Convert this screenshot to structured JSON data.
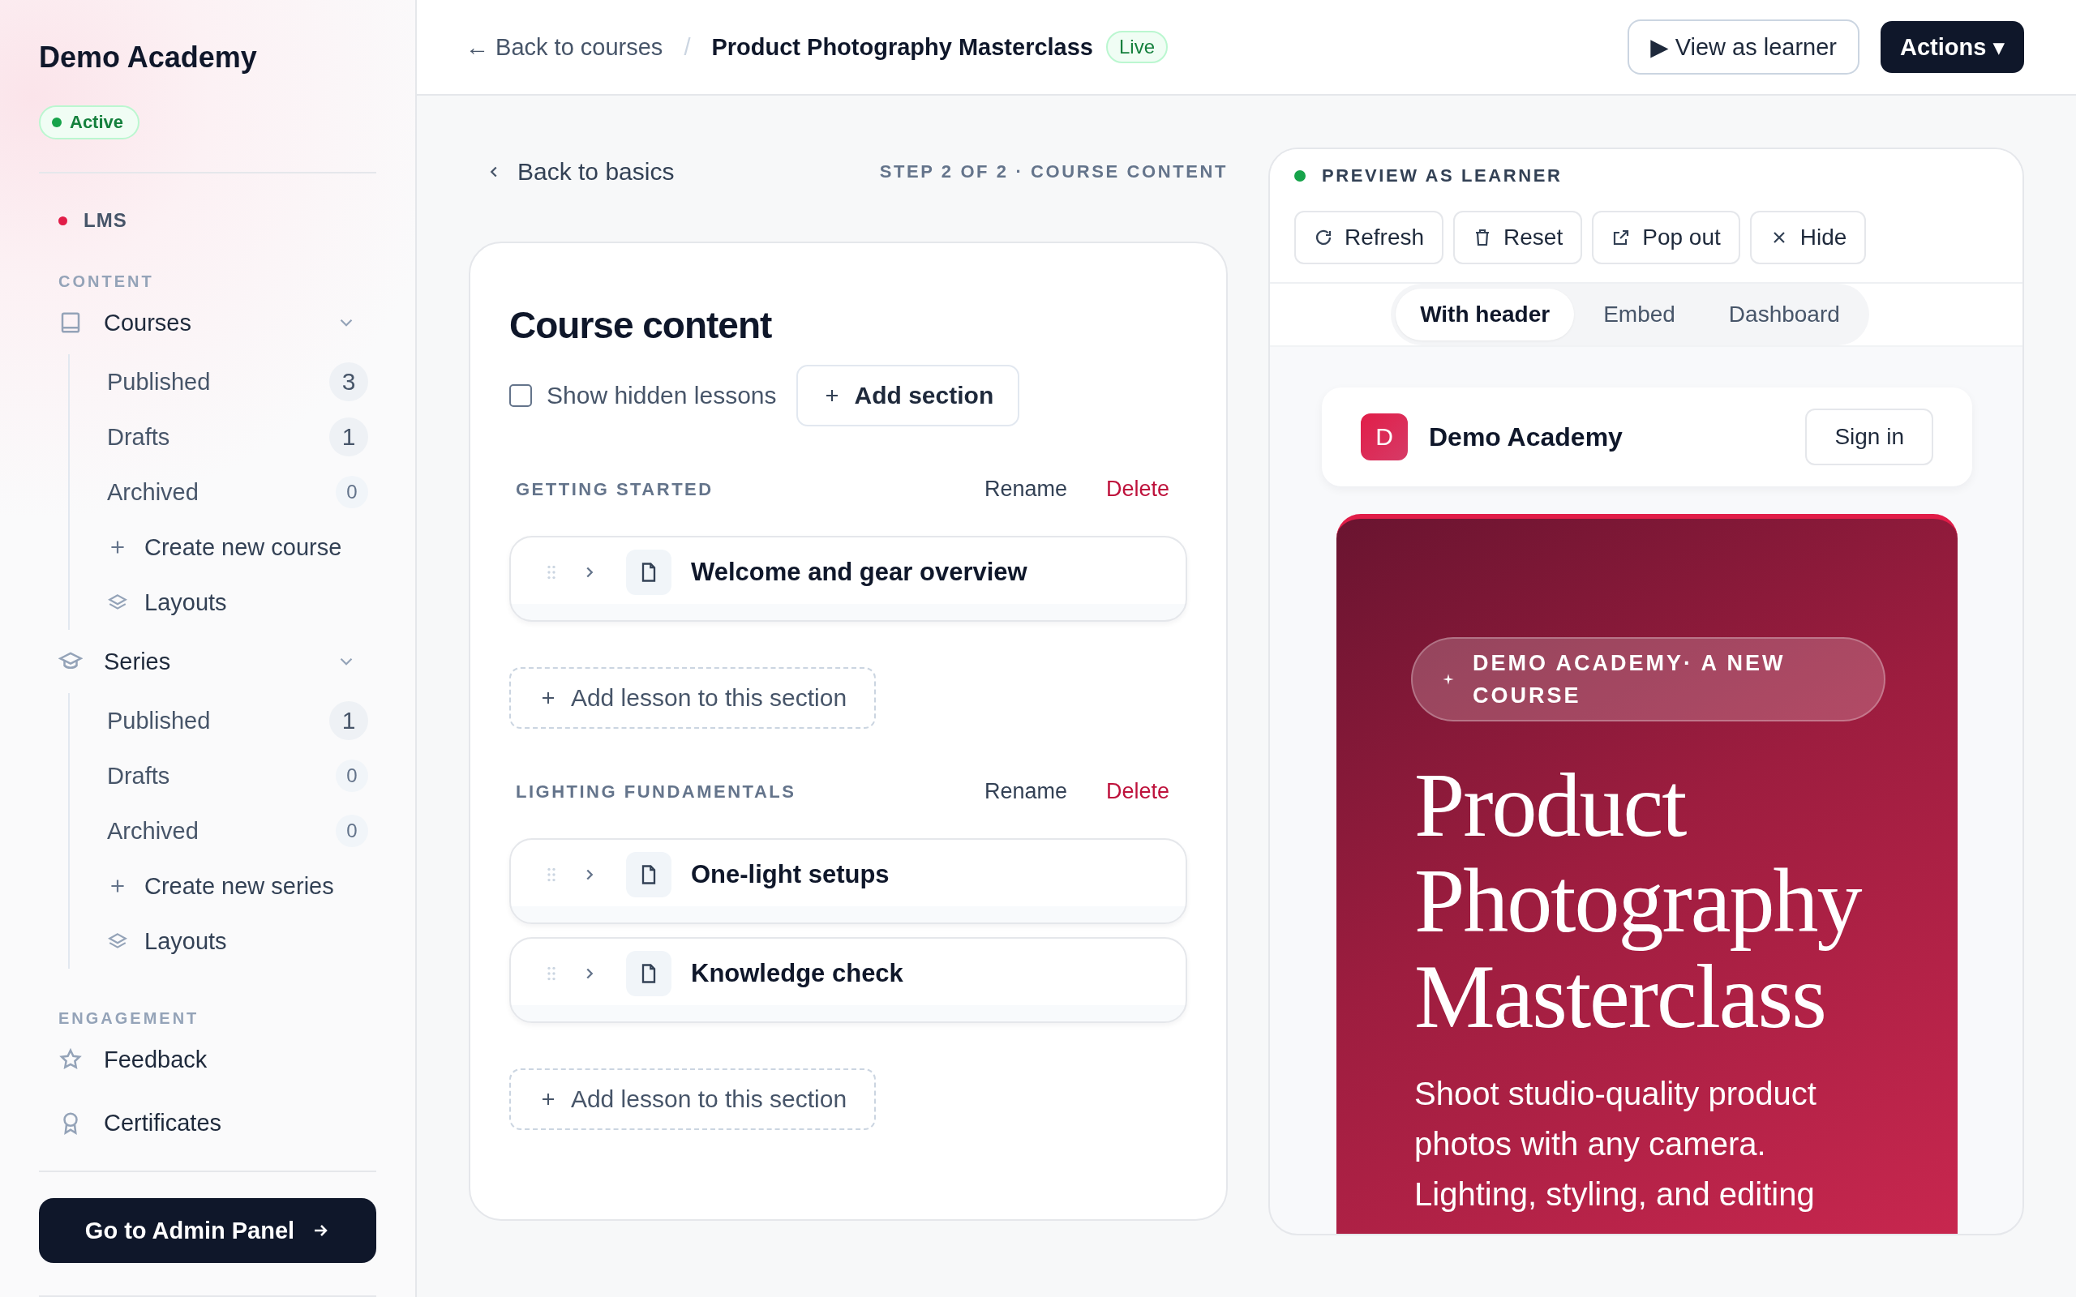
{
  "sidebar": {
    "title": "Demo Academy",
    "status": {
      "label": "Active"
    },
    "app": {
      "label": "LMS"
    },
    "groups": [
      {
        "heading": "CONTENT",
        "items": [
          {
            "label": "Courses",
            "kind": "book",
            "expanded": true,
            "children": [
              {
                "kind": "count",
                "label": "Published",
                "count": "3",
                "highlighted": true
              },
              {
                "kind": "count",
                "label": "Drafts",
                "count": "1",
                "highlighted": true
              },
              {
                "kind": "count",
                "label": "Archived",
                "count": "0",
                "highlighted": false
              },
              {
                "kind": "create",
                "label": "Create new course"
              },
              {
                "kind": "layouts",
                "label": "Layouts"
              }
            ]
          },
          {
            "label": "Series",
            "kind": "cap",
            "expanded": true,
            "children": [
              {
                "kind": "count",
                "label": "Published",
                "count": "1",
                "highlighted": true
              },
              {
                "kind": "count",
                "label": "Drafts",
                "count": "0",
                "highlighted": false
              },
              {
                "kind": "count",
                "label": "Archived",
                "count": "0",
                "highlighted": false
              },
              {
                "kind": "create",
                "label": "Create new series"
              },
              {
                "kind": "layouts",
                "label": "Layouts"
              }
            ]
          }
        ]
      },
      {
        "heading": "ENGAGEMENT",
        "items": [
          {
            "label": "Feedback",
            "kind": "star"
          },
          {
            "label": "Certificates",
            "kind": "ribbon"
          }
        ]
      }
    ],
    "admin_button": "Go to Admin Panel"
  },
  "topbar": {
    "back": "← Back to courses",
    "separator": "/",
    "crumb": "Product Photography Masterclass",
    "badge": "Live",
    "view_button": "▶ View as learner",
    "actions_button": "Actions ▾"
  },
  "editor": {
    "back": "Back to basics",
    "step": "STEP 2 OF 2 · COURSE CONTENT",
    "title": "Course content",
    "show_hidden": {
      "label": "Show hidden lessons",
      "checked": false
    },
    "add_section": "Add section",
    "sections": [
      {
        "name": "GETTING STARTED",
        "rename": "Rename",
        "delete": "Delete",
        "lessons": [
          {
            "title": "Welcome and gear overview"
          }
        ],
        "add_lesson": "Add lesson to this section"
      },
      {
        "name": "LIGHTING FUNDAMENTALS",
        "rename": "Rename",
        "delete": "Delete",
        "lessons": [
          {
            "title": "One-light setups"
          },
          {
            "title": "Knowledge check"
          }
        ],
        "add_lesson": "Add lesson to this section"
      }
    ]
  },
  "preview": {
    "heading": "PREVIEW AS LEARNER",
    "tools": [
      {
        "label": "Refresh",
        "kind": "refresh"
      },
      {
        "label": "Reset",
        "kind": "trash"
      },
      {
        "label": "Pop out",
        "kind": "external"
      },
      {
        "label": "Hide",
        "kind": "close"
      }
    ],
    "modes": [
      {
        "label": "With header",
        "selected": true
      },
      {
        "label": "Embed",
        "selected": false
      },
      {
        "label": "Dashboard",
        "selected": false
      }
    ],
    "site": {
      "initial": "D",
      "name": "Demo Academy",
      "sign_in": "Sign in"
    },
    "hero": {
      "eyebrow": "DEMO ACADEMY· A NEW COURSE",
      "title": "Product Photography Masterclass",
      "body": "Shoot studio-quality product photos with any camera. Lighting, styling, and editing"
    }
  }
}
